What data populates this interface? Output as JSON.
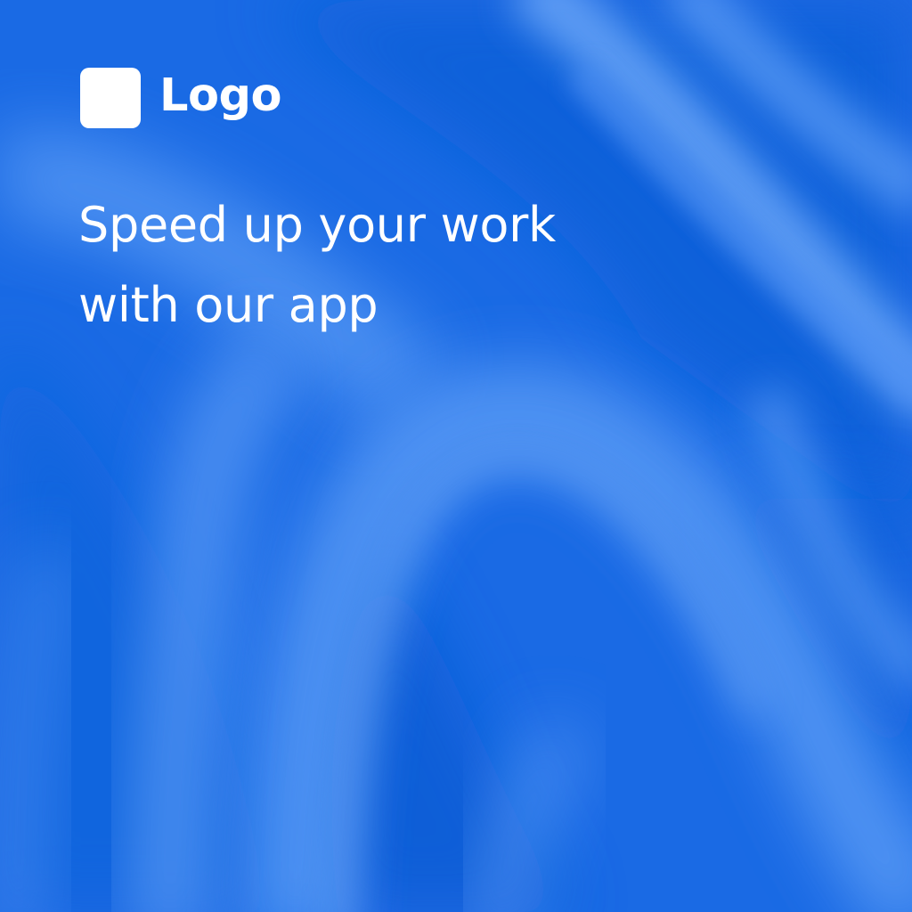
{
  "brand": {
    "logo_text": "Logo",
    "logo_mark_color": "#ffffff"
  },
  "headline": {
    "line1": "Speed up your work",
    "line2": "with our app"
  },
  "colors": {
    "background_base": "#1f6fe6",
    "background_dark": "#0a5fd8",
    "background_light": "#5b9cf6",
    "text": "#ffffff"
  }
}
